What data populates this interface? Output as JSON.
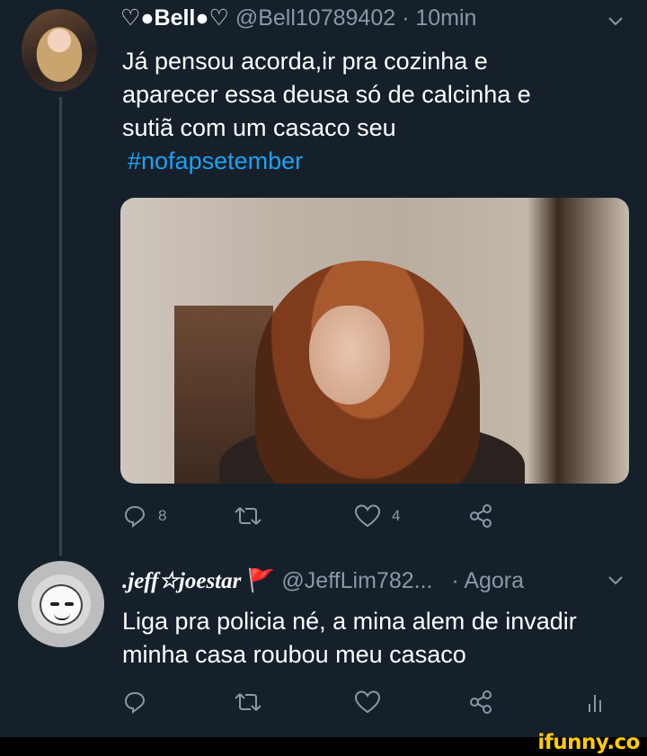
{
  "tweets": [
    {
      "display_name": "♡●Bell●♡",
      "handle": "@Bell10789402",
      "separator": "·",
      "time": "10min",
      "text_lines": [
        "Já pensou acorda,ir pra cozinha e",
        "aparecer essa deusa só de calcinha e",
        "sutiã com um casaco seu"
      ],
      "hashtag": "#nofapsetember",
      "reply_count": "8",
      "retweet_count": "",
      "like_count": "4"
    },
    {
      "display_name": ".jeff☆joestar",
      "flag": "🚩",
      "handle": "@JeffLim782...",
      "separator": "·",
      "time": "Agora",
      "text_lines": [
        "Liga pra policia né, a mina alem de invadir",
        "minha casa roubou meu casaco"
      ]
    }
  ],
  "watermark": "ifunny.co",
  "colors": {
    "background": "#15202b",
    "meta_text": "#8899a6",
    "hashtag": "#1da1f2",
    "flag": "#e0245e",
    "watermark": "#ffcc00"
  },
  "icons": [
    "reply-icon",
    "retweet-icon",
    "like-icon",
    "share-icon",
    "analytics-icon",
    "chevron-down-icon"
  ]
}
